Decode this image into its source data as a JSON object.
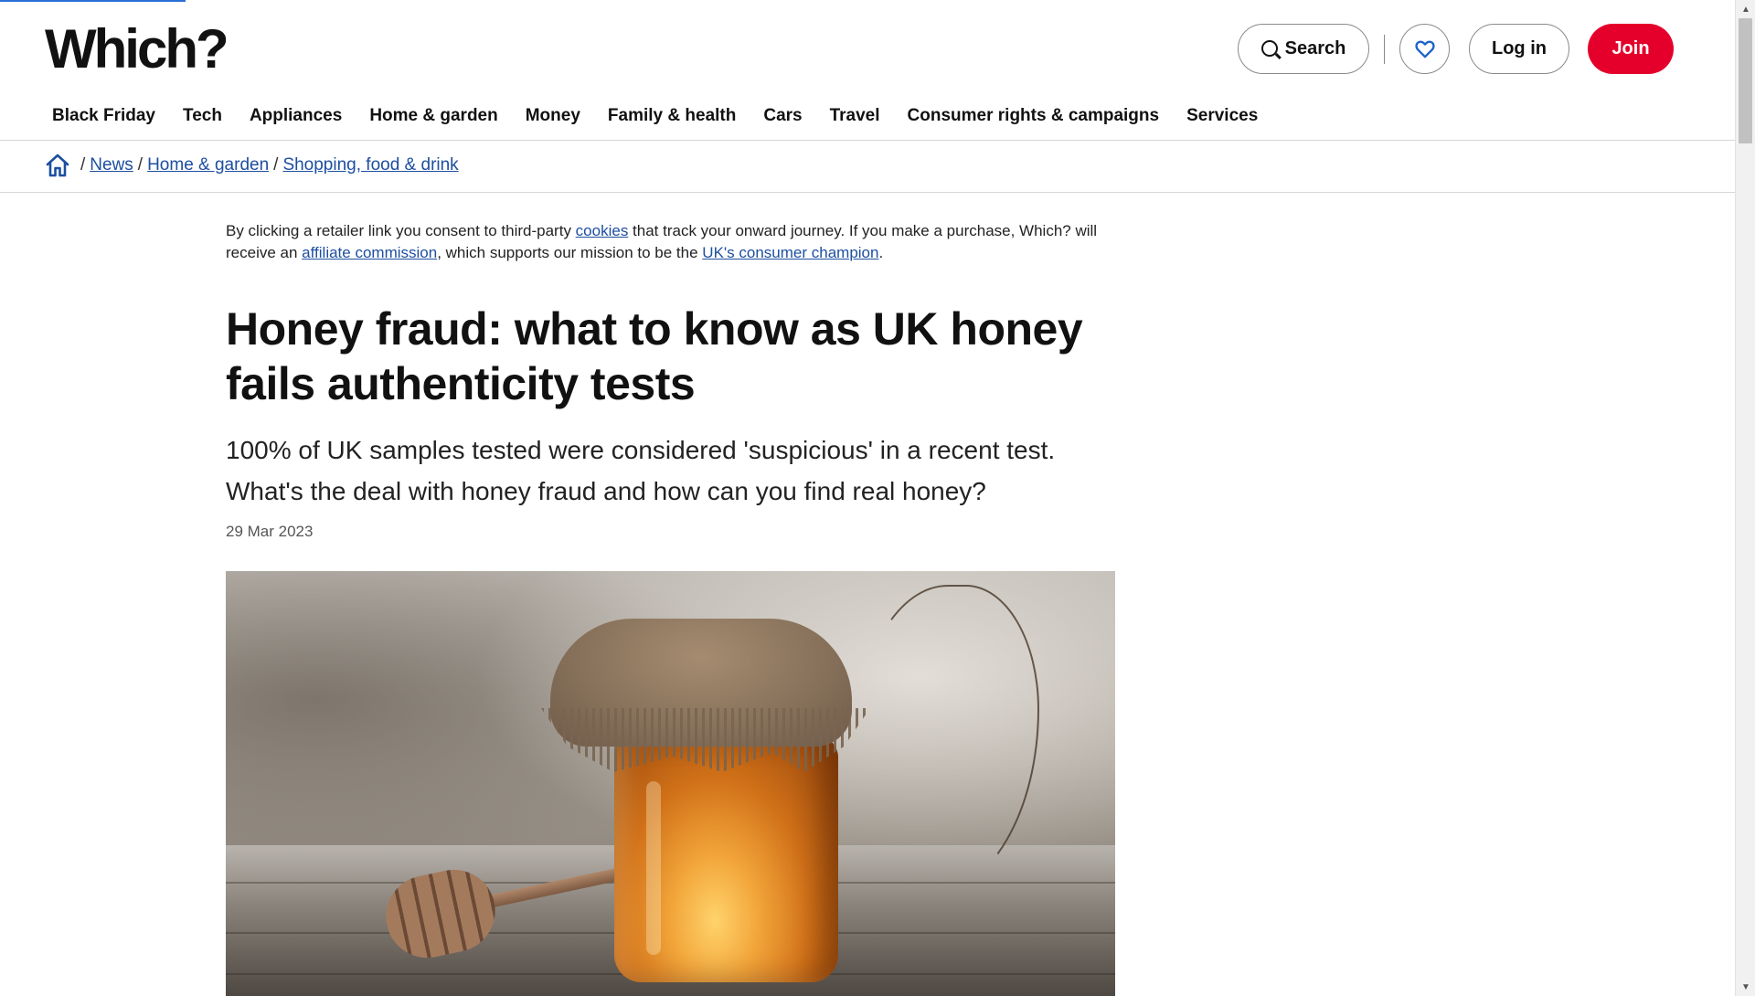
{
  "header": {
    "logo": "Which?",
    "search_label": "Search",
    "login_label": "Log in",
    "join_label": "Join",
    "icons": {
      "search": "search-icon",
      "favourites": "heart-icon",
      "home": "home-icon"
    }
  },
  "nav": {
    "items": [
      {
        "label": "Black Friday"
      },
      {
        "label": "Tech"
      },
      {
        "label": "Appliances"
      },
      {
        "label": "Home & garden"
      },
      {
        "label": "Money"
      },
      {
        "label": "Family & health"
      },
      {
        "label": "Cars"
      },
      {
        "label": "Travel"
      },
      {
        "label": "Consumer rights & campaigns"
      },
      {
        "label": "Services"
      }
    ]
  },
  "breadcrumb": {
    "items": [
      {
        "label": "News"
      },
      {
        "label": "Home & garden"
      },
      {
        "label": "Shopping, food & drink"
      }
    ],
    "separator": "/"
  },
  "article": {
    "consent_part1": "By clicking a retailer link you consent to third-party ",
    "consent_link1": "cookies",
    "consent_part2": " that track your onward journey. If you make a purchase, Which? will receive an ",
    "consent_link2": "affiliate commission",
    "consent_part3": ", which supports our mission to be the ",
    "consent_link3": "UK's consumer champion",
    "consent_part4": ".",
    "headline": "Honey fraud: what to know as UK honey fails authenticity tests",
    "standfirst": "100% of UK samples tested were considered 'suspicious' in a recent test. What's the deal with honey fraud and how can you find real honey?",
    "date": "29 Mar 2023"
  },
  "colors": {
    "brand_red": "#e4002b",
    "link_blue": "#1d4fa0",
    "heart_blue": "#1d63c9"
  }
}
